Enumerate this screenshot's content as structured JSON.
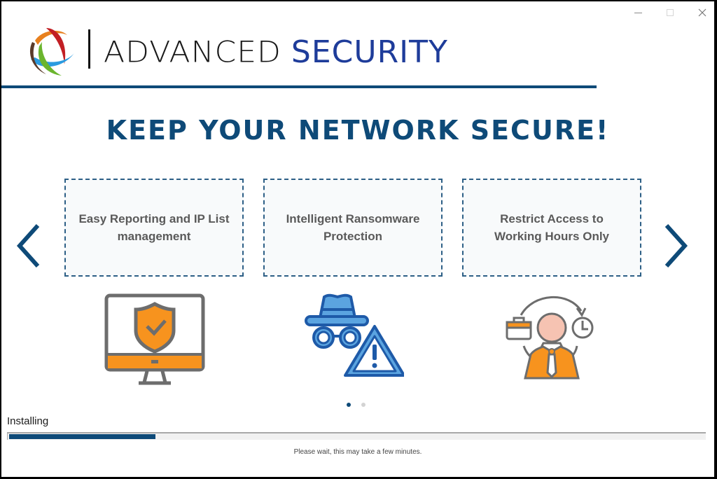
{
  "window": {
    "controls": {
      "minimize": "minimize-icon",
      "maximize": "maximize-icon",
      "close": "close-icon"
    }
  },
  "header": {
    "brand_primary": "ADVANCED",
    "brand_secondary": "SECURITY",
    "logo_icon": "globe-rings-logo"
  },
  "headline": "KEEP YOUR NETWORK SECURE!",
  "carousel": {
    "prev_icon": "chevron-left-icon",
    "next_icon": "chevron-right-icon",
    "cards": [
      {
        "text": "Easy Reporting and IP List management",
        "icon": "monitor-shield-icon"
      },
      {
        "text": "Intelligent Ransomware Protection",
        "icon": "spy-warning-icon"
      },
      {
        "text": "Restrict Access to Working Hours Only",
        "icon": "worker-clock-icon"
      }
    ],
    "page_count": 2,
    "active_page": 1
  },
  "colors": {
    "accent": "#0e4a78",
    "brand_blue": "#1e3c9a",
    "orange": "#f7931e",
    "icon_blue": "#5ba4e0"
  },
  "install": {
    "status": "Installing",
    "progress_percent": 21,
    "message": "Please wait, this may take a few minutes."
  }
}
